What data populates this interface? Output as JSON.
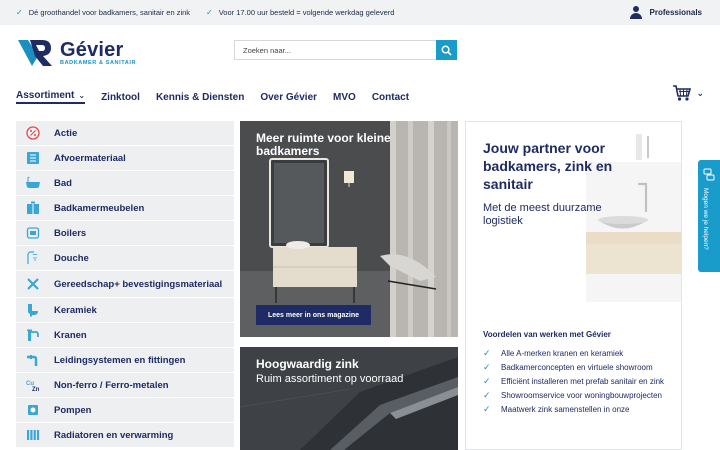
{
  "topbar": {
    "usps": [
      "Dé groothandel voor badkamers, sanitair en zink",
      "Voor 17.00 uur besteld = volgende werkdag geleverd"
    ],
    "professionals_label": "Professionals"
  },
  "logo": {
    "brand": "Gévier",
    "tagline": "BADKAMER & SANITAIR"
  },
  "search": {
    "placeholder": "Zoeken naar..."
  },
  "nav": {
    "items": [
      "Assortiment",
      "Zinktool",
      "Kennis & Diensten",
      "Over Gévier",
      "MVO",
      "Contact"
    ]
  },
  "sidebar": {
    "categories": [
      "Actie",
      "Afvoermateriaal",
      "Bad",
      "Badkamermeubelen",
      "Boilers",
      "Douche",
      "Gereedschap+ bevestigingsmateriaal",
      "Keramiek",
      "Kranen",
      "Leidingsystemen en fittingen",
      "Non-ferro / Ferro-metalen",
      "Pompen",
      "Radiatoren en verwarming"
    ]
  },
  "tiles": {
    "bathroom": {
      "title": "Meer ruimte voor kleine badkamers",
      "button": "Lees meer in ons magazine"
    },
    "zinc": {
      "title": "Hoogwaardig zink",
      "subtitle": "Ruim assortiment op voorraad"
    }
  },
  "panel": {
    "title": "Jouw partner voor badkamers, zink en sanitair",
    "subtitle": "Met de meest duurzame logistiek",
    "benefits_title": "Voordelen van werken met Gévier",
    "benefits": [
      "Alle A-merken kranen en keramiek",
      "Badkamerconcepten en virtuele showroom",
      "Efficiënt installeren met prefab sanitair en zink",
      "Showroomservice voor woningbouwprojecten",
      "Maatwerk zink samenstellen in onze"
    ]
  },
  "feedback": {
    "label": "Mogen we je helpen?"
  },
  "colors": {
    "navy": "#1e2b64",
    "accent": "#1a9ccb",
    "sidebar_bg": "#eeeff1",
    "topbar_bg": "#f1f2f4"
  }
}
